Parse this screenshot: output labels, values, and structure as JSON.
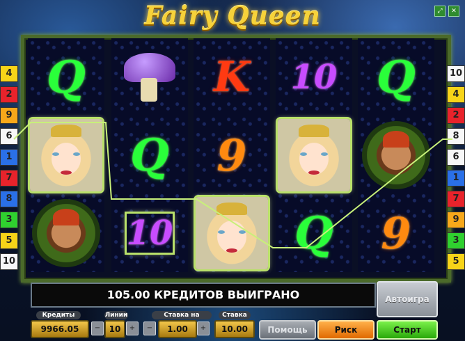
{
  "game": {
    "title": "Fairy Queen",
    "win_message": "105.00 КРЕДИТОВ ВЫИГРАНО",
    "corner_icons": [
      "expand-icon",
      "close-icon"
    ]
  },
  "lines_left": [
    "4",
    "2",
    "9",
    "6",
    "1",
    "7",
    "8",
    "3",
    "5",
    "10"
  ],
  "lines_right": [
    "10",
    "4",
    "2",
    "8",
    "6",
    "1",
    "7",
    "9",
    "3",
    "5"
  ],
  "line_colors": [
    "#f7d418",
    "#e8232b",
    "#f7a81a",
    "#f7f7f7",
    "#2a70e8",
    "#e8232b",
    "#2a70e8",
    "#2fd02f",
    "#f7d418",
    "#f7f7f7"
  ],
  "line_colors_right": [
    "#f7f7f7",
    "#f7d418",
    "#e8232b",
    "#f7f7f7",
    "#f7f7f7",
    "#2a70e8",
    "#e8232b",
    "#f7a81a",
    "#2fd02f",
    "#f7d418"
  ],
  "reels": [
    [
      "Q",
      "fairy",
      "elf"
    ],
    [
      "mushroom",
      "Q",
      "10"
    ],
    [
      "K",
      "9",
      "fairy"
    ],
    [
      "10",
      "fairy",
      "Q"
    ],
    [
      "Q",
      "elf",
      "9"
    ]
  ],
  "panel": {
    "credits_label": "Кредиты",
    "credits_value": "9966.05",
    "lines_label": "Линии",
    "lines_value": "10",
    "bet_label": "Ставка на линию",
    "bet_value": "1.00",
    "stake_label": "Ставка",
    "stake_value": "10.00",
    "minus": "−",
    "plus": "+",
    "auto_label": "Автоигра",
    "help_label": "Помощь",
    "risk_label": "Риск",
    "start_label": "Старт"
  }
}
